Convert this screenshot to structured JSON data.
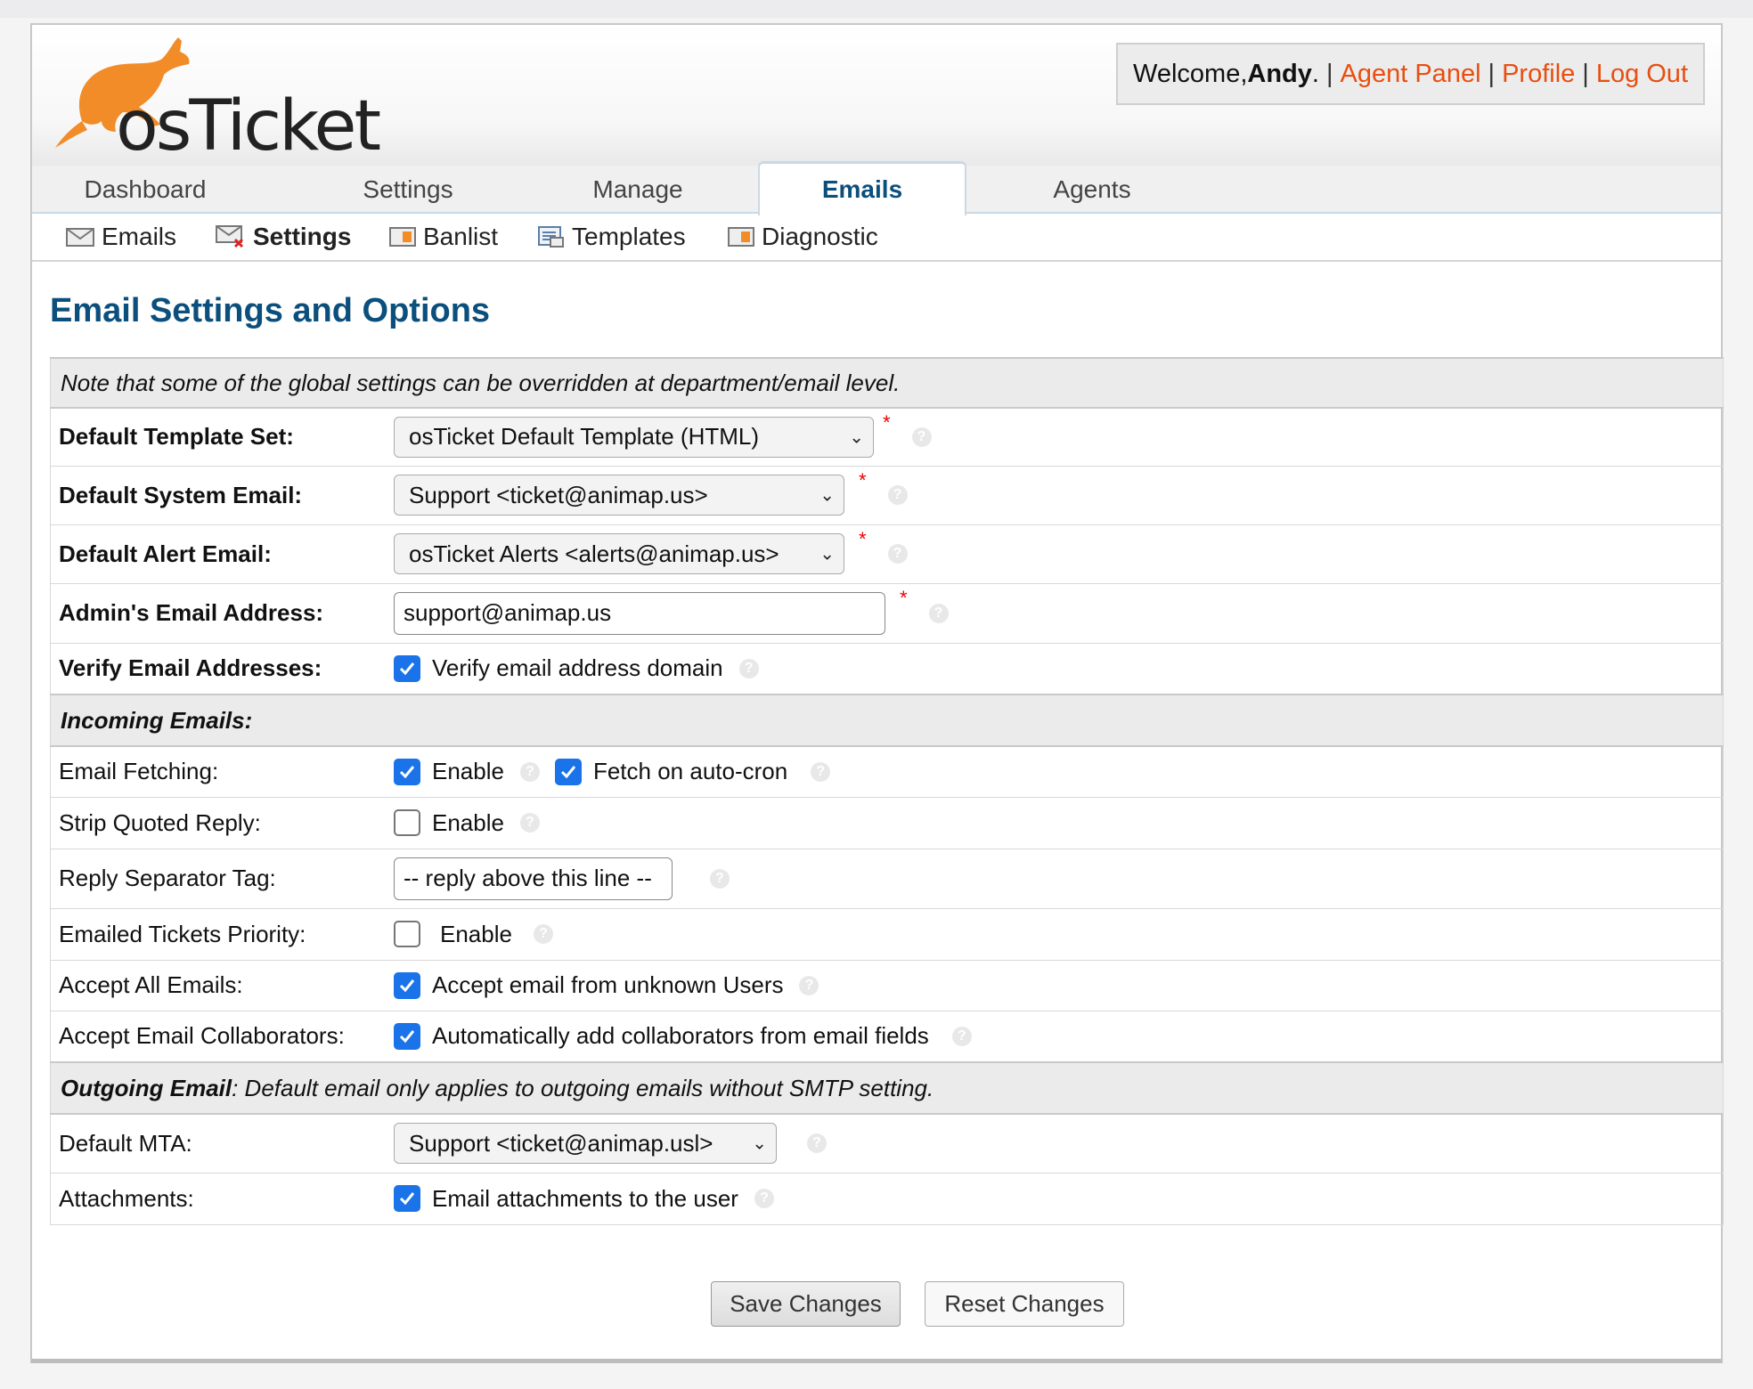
{
  "header": {
    "logo_text": "osTicket",
    "welcome_prefix": "Welcome, ",
    "user_name": "Andy",
    "welcome_suffix": ".",
    "links": [
      "Agent Panel",
      "Profile",
      "Log Out"
    ]
  },
  "nav": {
    "tabs": [
      {
        "label": "Dashboard",
        "active": false
      },
      {
        "label": "Settings",
        "active": false
      },
      {
        "label": "Manage",
        "active": false
      },
      {
        "label": "Emails",
        "active": true
      },
      {
        "label": "Agents",
        "active": false
      }
    ],
    "subnav": [
      {
        "label": "Emails",
        "icon": "email-icon"
      },
      {
        "label": "Settings",
        "icon": "email-settings-icon",
        "active": true
      },
      {
        "label": "Banlist",
        "icon": "banlist-icon"
      },
      {
        "label": "Templates",
        "icon": "templates-icon"
      },
      {
        "label": "Diagnostic",
        "icon": "diagnostic-icon"
      }
    ]
  },
  "page_title": "Email Settings and Options",
  "note": "Note that some of the global settings can be overridden at department/email level.",
  "general": {
    "default_template": {
      "label": "Default Template Set:",
      "value": "osTicket Default Template (HTML)"
    },
    "default_system_email": {
      "label": "Default System Email:",
      "value": "Support <ticket@animap.us>"
    },
    "default_alert_email": {
      "label": "Default Alert Email:",
      "value": "osTicket Alerts <alerts@animap.us>"
    },
    "admin_email": {
      "label": "Admin's Email Address:",
      "value": "support@animap.us"
    },
    "verify_email": {
      "label": "Verify Email Addresses:",
      "option": "Verify email address domain",
      "checked": true
    },
    "required_mark": "*"
  },
  "incoming": {
    "section_title": "Incoming Emails:",
    "email_fetching": {
      "label": "Email Fetching:",
      "enable": "Enable",
      "enable_checked": true,
      "autocron": "Fetch on auto-cron",
      "autocron_checked": true
    },
    "strip_quoted": {
      "label": "Strip Quoted Reply:",
      "option": "Enable",
      "checked": false
    },
    "reply_separator": {
      "label": "Reply Separator Tag:",
      "value": "-- reply above this line --"
    },
    "ticket_priority": {
      "label": "Emailed Tickets Priority:",
      "option": "Enable",
      "checked": false
    },
    "accept_all": {
      "label": "Accept All Emails:",
      "option": "Accept email from unknown Users",
      "checked": true
    },
    "collaborators": {
      "label": "Accept Email Collaborators:",
      "option": "Automatically add collaborators from email fields",
      "checked": true
    }
  },
  "outgoing": {
    "section_title": "Outgoing Email",
    "section_note": ": Default email only applies to outgoing emails without SMTP setting.",
    "default_mta": {
      "label": "Default MTA:",
      "value": "Support <ticket@animap.usl>"
    },
    "attachments": {
      "label": "Attachments:",
      "option": "Email attachments to the user",
      "checked": true
    }
  },
  "buttons": {
    "save": "Save Changes",
    "reset": "Reset Changes"
  },
  "colors": {
    "accent": "#0b4f7d",
    "link": "#e84e10",
    "logo_orange": "#f28c28",
    "checkbox": "#1a73e8"
  }
}
